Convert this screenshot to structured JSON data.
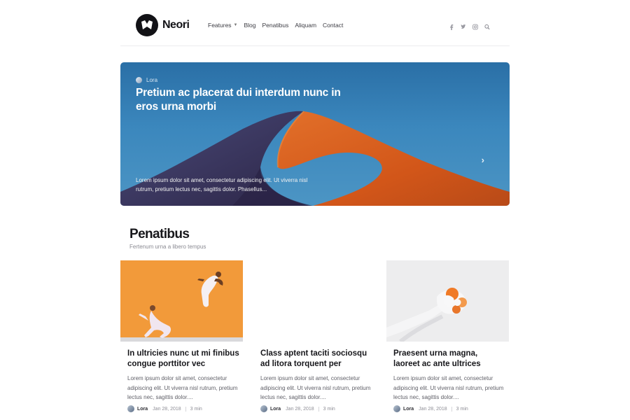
{
  "brand": {
    "name": "Neori"
  },
  "nav": {
    "items": [
      {
        "label": "Features",
        "has_dropdown": true
      },
      {
        "label": "Blog"
      },
      {
        "label": "Penatibus"
      },
      {
        "label": "Aliquam"
      },
      {
        "label": "Contact"
      }
    ],
    "social_icons": [
      "facebook-icon",
      "twitter-icon",
      "instagram-icon",
      "search-icon"
    ]
  },
  "hero": {
    "author": "Lora",
    "title": "Pretium ac placerat dui interdum nunc in eros urna morbi",
    "excerpt": "Lorem ipsum dolor sit amet, consectetur adipiscing elit. Ut viverra nisl rutrum, pretium lectus nec, sagittis dolor. Phasellus...",
    "next_icon": "chevron-right-icon"
  },
  "section": {
    "title": "Penatibus",
    "subtitle": "Fertenum urna a libero tempus"
  },
  "cards": [
    {
      "title": "In ultricies nunc ut mi finibus congue porttitor vec",
      "excerpt": "Lorem ipsum dolor sit amet, consectetur adipiscing elit. Ut viverra nisl rutrum, pretium lectus nec, sagittis dolor....",
      "author": "Lora",
      "date": "Jan 28, 2018",
      "read_time": "3 min"
    },
    {
      "title": "Class aptent taciti sociosqu ad litora torquent per",
      "excerpt": "Lorem ipsum dolor sit amet, consectetur adipiscing elit. Ut viverra nisl rutrum, pretium lectus nec, sagittis dolor....",
      "author": "Lora",
      "date": "Jan 28, 2018",
      "read_time": "3 min"
    },
    {
      "title": "Praesent urna magna, laoreet ac ante ultrices",
      "excerpt": "Lorem ipsum dolor sit amet, consectetur adipiscing elit. Ut viverra nisl rutrum, pretium lectus nec, sagittis dolor....",
      "author": "Lora",
      "date": "Jan 28, 2018",
      "read_time": "3 min"
    }
  ]
}
